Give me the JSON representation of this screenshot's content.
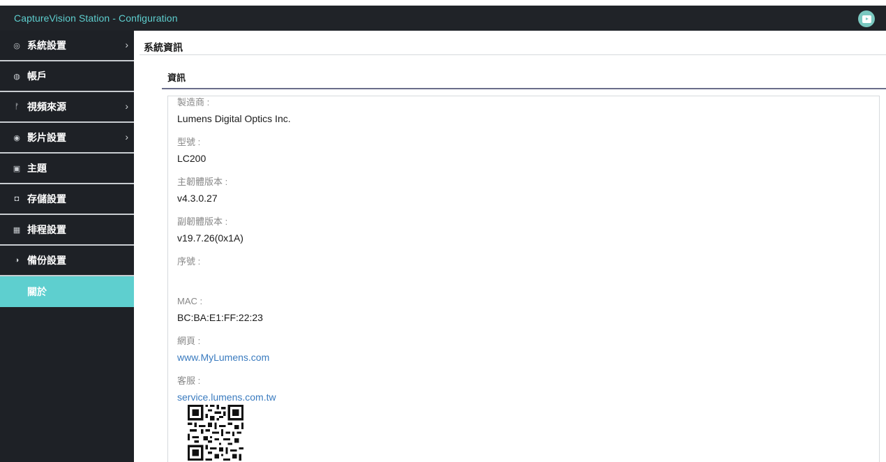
{
  "window": {
    "title": "CaptureVision Station - Configuration",
    "app_icon": "play-icon"
  },
  "sidebar": {
    "items": [
      {
        "icon": "gear-icon",
        "glyph": "◎",
        "label": "系統設置",
        "has_chevron": true
      },
      {
        "icon": "user-icon",
        "glyph": "◍",
        "label": "帳戶",
        "has_chevron": false
      },
      {
        "icon": "network-icon",
        "glyph": "ᚠ",
        "label": "視頻來源",
        "has_chevron": true
      },
      {
        "icon": "record-icon",
        "glyph": "◉",
        "label": "影片設置",
        "has_chevron": true
      },
      {
        "icon": "theme-icon",
        "glyph": "▣",
        "label": "主題",
        "has_chevron": false
      },
      {
        "icon": "storage-icon",
        "glyph": "◘",
        "label": "存儲設置",
        "has_chevron": false
      },
      {
        "icon": "schedule-icon",
        "glyph": "▦",
        "label": "排程設置",
        "has_chevron": false
      },
      {
        "icon": "backup-icon",
        "glyph": "◑",
        "label": "備份設置",
        "has_chevron": false
      },
      {
        "icon": "",
        "glyph": "",
        "label": "關於",
        "has_chevron": false,
        "active": true
      }
    ],
    "chevron": "›",
    "active_color": "#5ecfcf"
  },
  "main": {
    "page_title": "系統資訊",
    "section_title": "資訊",
    "fields": [
      {
        "label": "製造商 :",
        "value": "Lumens Digital Optics Inc."
      },
      {
        "label": "型號 :",
        "value": "LC200"
      },
      {
        "label": "主韌體版本 :",
        "value": "v4.3.0.27"
      },
      {
        "label": "副韌體版本 :",
        "value": "v19.7.26(0x1A)"
      },
      {
        "label": "序號 :",
        "value": ""
      },
      {
        "label": "MAC :",
        "value": "BC:BA:E1:FF:22:23"
      },
      {
        "label": "網頁 :",
        "value": "www.MyLumens.com",
        "link": true
      },
      {
        "label": "客服 :",
        "value": "service.lumens.com.tw",
        "link": true
      }
    ],
    "qr_icon": "qr-code-icon"
  },
  "colors": {
    "title_bar_bg": "#202328",
    "title_text": "#5ecfcf",
    "sidebar_bg": "#1e2126",
    "link": "#3a7bbf"
  }
}
